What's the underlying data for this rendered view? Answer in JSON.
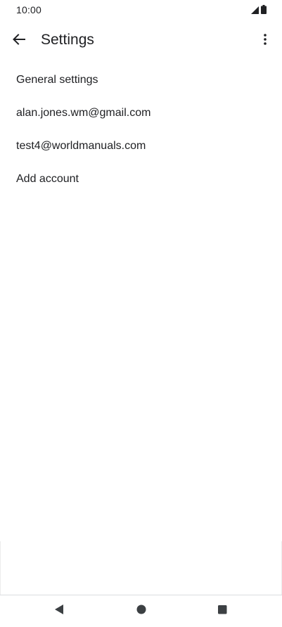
{
  "status_bar": {
    "time": "10:00",
    "icons": [
      "signal-icon",
      "battery-icon"
    ]
  },
  "app_bar": {
    "back_icon": "arrow-left-icon",
    "title": "Settings",
    "overflow_icon": "more-vert-icon"
  },
  "settings": {
    "items": [
      {
        "label": "General settings"
      },
      {
        "label": "alan.jones.wm@gmail.com"
      },
      {
        "label": "test4@worldmanuals.com"
      },
      {
        "label": "Add account"
      }
    ]
  },
  "nav_bar": {
    "icons": [
      "nav-back-icon",
      "nav-home-icon",
      "nav-recents-icon"
    ],
    "color": "#3c4043"
  }
}
